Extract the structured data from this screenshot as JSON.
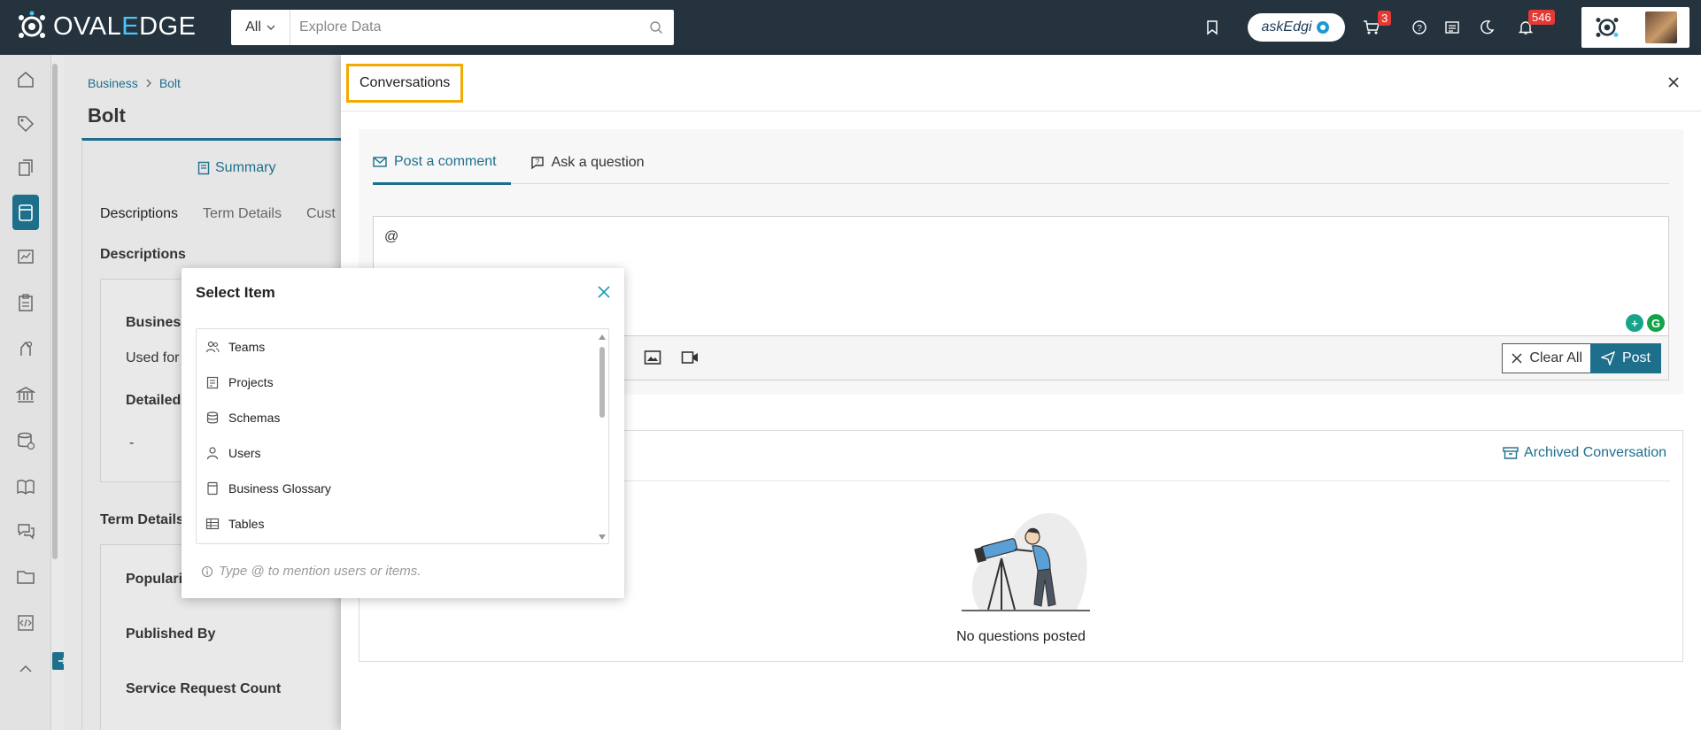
{
  "app": {
    "logo_text_a": "OVAL",
    "logo_text_b": "E",
    "logo_text_c": "DGE"
  },
  "search": {
    "scope": "All",
    "placeholder": "Explore Data"
  },
  "topbar": {
    "askedgi_label": "askEdgi",
    "cart_count": "3",
    "notification_count": "546"
  },
  "page": {
    "breadcrumb": [
      "Business",
      "Bolt"
    ],
    "title": "Bolt",
    "summary_tab": "Summary",
    "tabs": [
      "Descriptions",
      "Term Details",
      "Cust"
    ],
    "section_descriptions": "Descriptions",
    "business_label": "Business",
    "used_for": "Used for",
    "detailed_label": "Detailed",
    "dash": "-",
    "section_term_details": "Term Details",
    "popularity": "Popularit",
    "published_by": "Published By",
    "service_request_count": "Service Request Count"
  },
  "drawer": {
    "title": "Conversations",
    "tabs": [
      {
        "label": "Post a comment",
        "active": true
      },
      {
        "label": "Ask a question",
        "active": false
      }
    ],
    "editor_value": "@",
    "clear_all": "Clear All",
    "post": "Post",
    "archived": "Archived Conversation",
    "empty_text": "No questions posted"
  },
  "popup": {
    "title": "Select Item",
    "items": [
      {
        "label": "Teams",
        "icon": "teams-icon"
      },
      {
        "label": "Projects",
        "icon": "projects-icon"
      },
      {
        "label": "Schemas",
        "icon": "schemas-icon"
      },
      {
        "label": "Users",
        "icon": "users-icon"
      },
      {
        "label": "Business Glossary",
        "icon": "glossary-icon"
      },
      {
        "label": "Tables",
        "icon": "tables-icon"
      }
    ],
    "hint": "Type @ to mention users or items."
  },
  "colors": {
    "accent": "#1d6f8c",
    "topbar": "#24333d",
    "highlight": "#f2a900",
    "badge": "#e53935"
  }
}
